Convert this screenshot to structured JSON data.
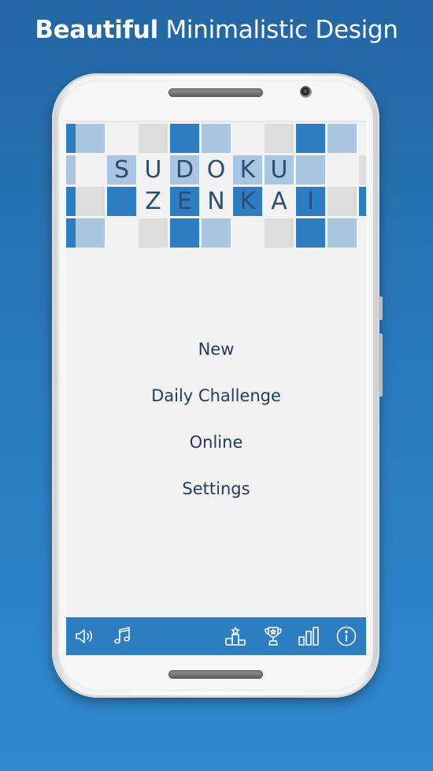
{
  "headline": {
    "bold": "Beautiful",
    "light": "Minimalistic Design"
  },
  "app": {
    "logo_line1": [
      "S",
      "U",
      "D",
      "O",
      "K",
      "U"
    ],
    "logo_line2": [
      "Z",
      "E",
      "N",
      "K",
      "A",
      "I"
    ]
  },
  "menu": {
    "items": [
      {
        "label": "New"
      },
      {
        "label": "Daily Challenge"
      },
      {
        "label": "Online"
      },
      {
        "label": "Settings"
      }
    ]
  },
  "toolbar": {
    "icons": [
      "speaker-icon",
      "music-note-icon",
      "podium-icon",
      "trophy-icon",
      "bar-chart-icon",
      "info-icon"
    ]
  },
  "colors": {
    "background": "#2a7cc0",
    "tile_dark": "#2d7dc3",
    "tile_light": "#a8c6df",
    "tile_gray": "#dcdcdc",
    "text_dark": "#243b5e",
    "toolbar": "#2d7dc3"
  }
}
